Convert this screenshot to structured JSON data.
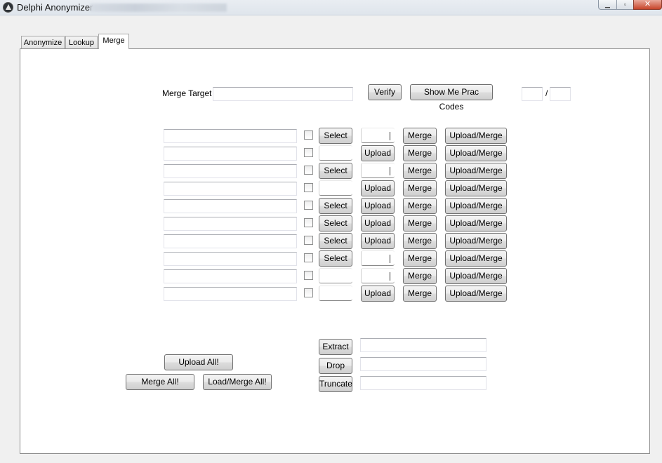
{
  "window": {
    "title": "Delphi Anonymizer",
    "minimize_icon": "minimize-icon",
    "maximize_icon": "maximize-icon",
    "close_icon": "close-icon",
    "close_glyph": "✕"
  },
  "tabs": [
    {
      "label": "Anonymize",
      "active": false
    },
    {
      "label": "Lookup",
      "active": false
    },
    {
      "label": "Merge",
      "active": true
    }
  ],
  "merge_target": {
    "label": "Merge Target",
    "value": ""
  },
  "verify_label": "Verify",
  "prac_codes_label": "Show Me Prac Codes",
  "counter": {
    "separator": "/",
    "left": "",
    "right": ""
  },
  "rows": [
    {
      "checked": false,
      "slot1": "Select",
      "slot2": "mark"
    },
    {
      "checked": false,
      "slot1": "empty",
      "slot2": "Upload"
    },
    {
      "checked": false,
      "slot1": "Select",
      "slot2": "mark"
    },
    {
      "checked": false,
      "slot1": "empty",
      "slot2": "Upload"
    },
    {
      "checked": false,
      "slot1": "Select",
      "slot2": "Upload"
    },
    {
      "checked": false,
      "slot1": "Select",
      "slot2": "Upload"
    },
    {
      "checked": false,
      "slot1": "Select",
      "slot2": "Upload"
    },
    {
      "checked": false,
      "slot1": "Select",
      "slot2": "mark"
    },
    {
      "checked": false,
      "slot1": "empty",
      "slot2": "mark"
    },
    {
      "checked": false,
      "slot1": "empty",
      "slot2": "Upload"
    }
  ],
  "row_labels": {
    "merge": "Merge",
    "upload_merge": "Upload/Merge"
  },
  "bottom": {
    "upload_all": "Upload All!",
    "merge_all": "Merge All!",
    "load_merge_all": "Load/Merge All!",
    "extract": "Extract",
    "drop": "Drop",
    "truncate": "Truncate"
  }
}
